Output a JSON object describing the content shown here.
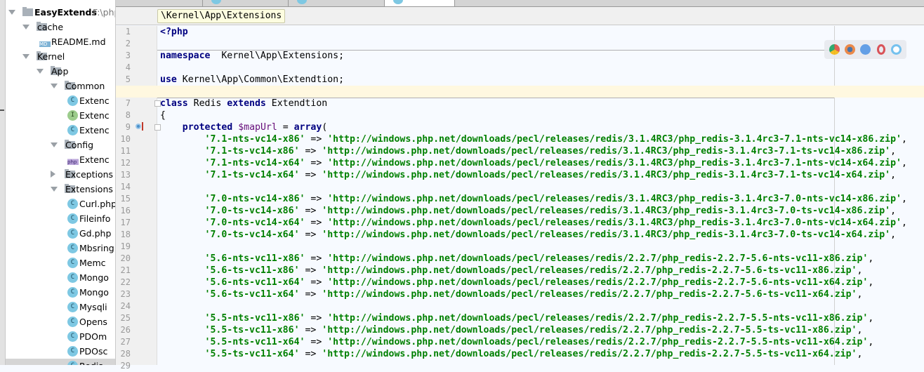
{
  "project": {
    "root": {
      "name": "EasyExtends",
      "path": "F:\\php"
    },
    "items": [
      {
        "label": "cache",
        "type": "folder"
      },
      {
        "label": "README.md",
        "type": "md"
      },
      {
        "label": "Kernel",
        "type": "folder"
      },
      {
        "label": "App",
        "type": "folder"
      },
      {
        "label": "Common",
        "type": "folder"
      },
      {
        "label": "Extenc",
        "type": "class"
      },
      {
        "label": "Extenc",
        "type": "interface"
      },
      {
        "label": "Extenc",
        "type": "class"
      },
      {
        "label": "Config",
        "type": "folder"
      },
      {
        "label": "Extenc",
        "type": "php"
      },
      {
        "label": "Exceptions",
        "type": "folder"
      },
      {
        "label": "Extensions",
        "type": "folder"
      },
      {
        "label": "Curl.php",
        "type": "class"
      },
      {
        "label": "Fileinfo",
        "type": "class"
      },
      {
        "label": "Gd.php",
        "type": "class"
      },
      {
        "label": "Mbsring",
        "type": "class"
      },
      {
        "label": "Memc",
        "type": "class"
      },
      {
        "label": "Mongo",
        "type": "class"
      },
      {
        "label": "Mongo",
        "type": "class"
      },
      {
        "label": "Mysqli",
        "type": "class"
      },
      {
        "label": "Opens",
        "type": "class"
      },
      {
        "label": "PDOm",
        "type": "class"
      },
      {
        "label": "PDOsc",
        "type": "class"
      },
      {
        "label": "Redis",
        "type": "class"
      }
    ],
    "icon_letters": {
      "class": "C",
      "interface": "I",
      "md": "MD",
      "php": "php"
    }
  },
  "editor": {
    "breadcrumb": "\\Kernel\\App\\Extensions",
    "current_line": 6,
    "browsers": [
      "chrome-icon",
      "firefox-icon",
      "safari-icon",
      "opera-icon",
      "ie-icon"
    ],
    "lines": [
      [
        [
          "kw",
          "<?php"
        ]
      ],
      [],
      [
        [
          "kw",
          "namespace"
        ],
        [
          "",
          "  Kernel\\App\\Extensions;"
        ]
      ],
      [],
      [
        [
          "kw",
          "use"
        ],
        [
          "",
          " Kernel\\App\\Common\\Extendtion;"
        ]
      ],
      [],
      [
        [
          "kw",
          "class"
        ],
        [
          "",
          " Redis "
        ],
        [
          "kw",
          "extends"
        ],
        [
          "",
          " Extendtion"
        ]
      ],
      [
        [
          "",
          "{"
        ]
      ],
      [
        [
          "",
          "    "
        ],
        [
          "kw",
          "protected"
        ],
        [
          "",
          " "
        ],
        [
          "var",
          "$mapUrl"
        ],
        [
          "",
          " = "
        ],
        [
          "kw",
          "array"
        ],
        [
          "",
          "("
        ]
      ],
      [
        [
          "",
          "        "
        ],
        [
          "str",
          "'7.1-nts-vc14-x86'"
        ],
        [
          "",
          " => "
        ],
        [
          "str",
          "'http://windows.php.net/downloads/pecl/releases/redis/3.1.4RC3/php_redis-3.1.4rc3-7.1-nts-vc14-x86.zip'"
        ],
        [
          "",
          ","
        ]
      ],
      [
        [
          "",
          "        "
        ],
        [
          "str",
          "'7.1-ts-vc14-x86'"
        ],
        [
          "",
          " => "
        ],
        [
          "str",
          "'http://windows.php.net/downloads/pecl/releases/redis/3.1.4RC3/php_redis-3.1.4rc3-7.1-ts-vc14-x86.zip'"
        ],
        [
          "",
          ","
        ]
      ],
      [
        [
          "",
          "        "
        ],
        [
          "str",
          "'7.1-nts-vc14-x64'"
        ],
        [
          "",
          " => "
        ],
        [
          "str",
          "'http://windows.php.net/downloads/pecl/releases/redis/3.1.4RC3/php_redis-3.1.4rc3-7.1-nts-vc14-x64.zip'"
        ],
        [
          "",
          ","
        ]
      ],
      [
        [
          "",
          "        "
        ],
        [
          "str",
          "'7.1-ts-vc14-x64'"
        ],
        [
          "",
          " => "
        ],
        [
          "str",
          "'http://windows.php.net/downloads/pecl/releases/redis/3.1.4RC3/php_redis-3.1.4rc3-7.1-ts-vc14-x64.zip'"
        ],
        [
          "",
          ","
        ]
      ],
      [],
      [
        [
          "",
          "        "
        ],
        [
          "str",
          "'7.0-nts-vc14-x86'"
        ],
        [
          "",
          " => "
        ],
        [
          "str",
          "'http://windows.php.net/downloads/pecl/releases/redis/3.1.4RC3/php_redis-3.1.4rc3-7.0-nts-vc14-x86.zip'"
        ],
        [
          "",
          ","
        ]
      ],
      [
        [
          "",
          "        "
        ],
        [
          "str",
          "'7.0-ts-vc14-x86'"
        ],
        [
          "",
          " => "
        ],
        [
          "str",
          "'http://windows.php.net/downloads/pecl/releases/redis/3.1.4RC3/php_redis-3.1.4rc3-7.0-ts-vc14-x86.zip'"
        ],
        [
          "",
          ","
        ]
      ],
      [
        [
          "",
          "        "
        ],
        [
          "str",
          "'7.0-nts-vc14-x64'"
        ],
        [
          "",
          " => "
        ],
        [
          "str",
          "'http://windows.php.net/downloads/pecl/releases/redis/3.1.4RC3/php_redis-3.1.4rc3-7.0-nts-vc14-x64.zip'"
        ],
        [
          "",
          ","
        ]
      ],
      [
        [
          "",
          "        "
        ],
        [
          "str",
          "'7.0-ts-vc14-x64'"
        ],
        [
          "",
          " => "
        ],
        [
          "str",
          "'http://windows.php.net/downloads/pecl/releases/redis/3.1.4RC3/php_redis-3.1.4rc3-7.0-ts-vc14-x64.zip'"
        ],
        [
          "",
          ","
        ]
      ],
      [],
      [
        [
          "",
          "        "
        ],
        [
          "str",
          "'5.6-nts-vc11-x86'"
        ],
        [
          "",
          " => "
        ],
        [
          "str",
          "'http://windows.php.net/downloads/pecl/releases/redis/2.2.7/php_redis-2.2.7-5.6-nts-vc11-x86.zip'"
        ],
        [
          "",
          ","
        ]
      ],
      [
        [
          "",
          "        "
        ],
        [
          "str",
          "'5.6-ts-vc11-x86'"
        ],
        [
          "",
          " => "
        ],
        [
          "str",
          "'http://windows.php.net/downloads/pecl/releases/redis/2.2.7/php_redis-2.2.7-5.6-ts-vc11-x86.zip'"
        ],
        [
          "",
          ","
        ]
      ],
      [
        [
          "",
          "        "
        ],
        [
          "str",
          "'5.6-nts-vc11-x64'"
        ],
        [
          "",
          " => "
        ],
        [
          "str",
          "'http://windows.php.net/downloads/pecl/releases/redis/2.2.7/php_redis-2.2.7-5.6-nts-vc11-x64.zip'"
        ],
        [
          "",
          ","
        ]
      ],
      [
        [
          "",
          "        "
        ],
        [
          "str",
          "'5.6-ts-vc11-x64'"
        ],
        [
          "",
          " => "
        ],
        [
          "str",
          "'http://windows.php.net/downloads/pecl/releases/redis/2.2.7/php_redis-2.2.7-5.6-ts-vc11-x64.zip'"
        ],
        [
          "",
          ","
        ]
      ],
      [],
      [
        [
          "",
          "        "
        ],
        [
          "str",
          "'5.5-nts-vc11-x86'"
        ],
        [
          "",
          " => "
        ],
        [
          "str",
          "'http://windows.php.net/downloads/pecl/releases/redis/2.2.7/php_redis-2.2.7-5.5-nts-vc11-x86.zip'"
        ],
        [
          "",
          ","
        ]
      ],
      [
        [
          "",
          "        "
        ],
        [
          "str",
          "'5.5-ts-vc11-x86'"
        ],
        [
          "",
          " => "
        ],
        [
          "str",
          "'http://windows.php.net/downloads/pecl/releases/redis/2.2.7/php_redis-2.2.7-5.5-ts-vc11-x86.zip'"
        ],
        [
          "",
          ","
        ]
      ],
      [
        [
          "",
          "        "
        ],
        [
          "str",
          "'5.5-nts-vc11-x64'"
        ],
        [
          "",
          " => "
        ],
        [
          "str",
          "'http://windows.php.net/downloads/pecl/releases/redis/2.2.7/php_redis-2.2.7-5.5-nts-vc11-x64.zip'"
        ],
        [
          "",
          ","
        ]
      ],
      [
        [
          "",
          "        "
        ],
        [
          "str",
          "'5.5-ts-vc11-x64'"
        ],
        [
          "",
          " => "
        ],
        [
          "str",
          "'http://windows.php.net/downloads/pecl/releases/redis/2.2.7/php_redis-2.2.7-5.5-ts-vc11-x64.zip'"
        ],
        [
          "",
          ","
        ]
      ],
      []
    ]
  }
}
